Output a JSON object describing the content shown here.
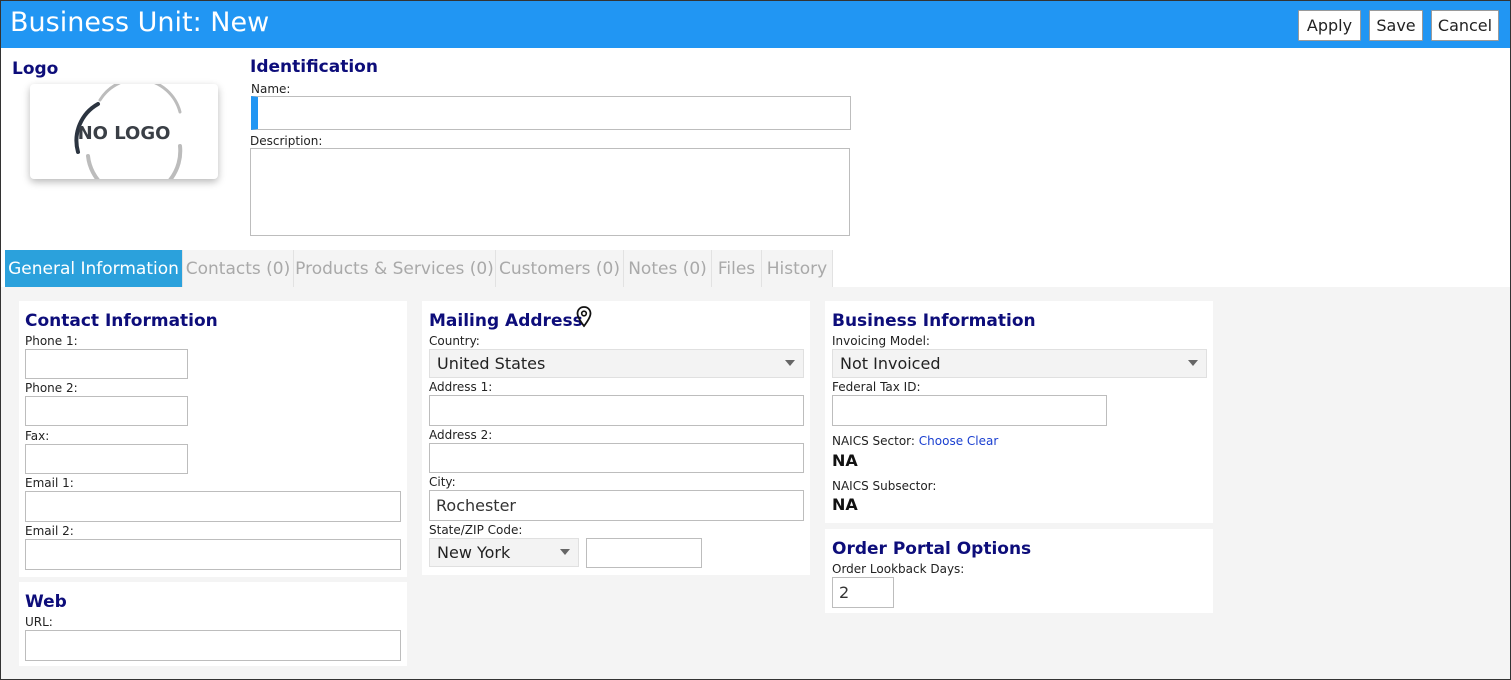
{
  "header": {
    "title": "Business Unit: New",
    "apply_label": "Apply",
    "save_label": "Save",
    "cancel_label": "Cancel"
  },
  "logo": {
    "heading": "Logo",
    "placeholder_text": "NO LOGO"
  },
  "identification": {
    "heading": "Identification",
    "name_label": "Name:",
    "name_value": "",
    "description_label": "Description:",
    "description_value": ""
  },
  "tabs": [
    {
      "label": "General Information",
      "active": true
    },
    {
      "label": "Contacts (0)",
      "active": false
    },
    {
      "label": "Products & Services (0)",
      "active": false
    },
    {
      "label": "Customers (0)",
      "active": false
    },
    {
      "label": "Notes (0)",
      "active": false
    },
    {
      "label": "Files",
      "active": false
    },
    {
      "label": "History",
      "active": false
    }
  ],
  "contact_info": {
    "heading": "Contact Information",
    "phone1_label": "Phone 1:",
    "phone2_label": "Phone 2:",
    "fax_label": "Fax:",
    "email1_label": "Email 1:",
    "email2_label": "Email 2:"
  },
  "web": {
    "heading": "Web",
    "url_label": "URL:"
  },
  "mailing_address": {
    "heading": "Mailing Address",
    "country_label": "Country:",
    "country_value": "United States",
    "address1_label": "Address 1:",
    "address2_label": "Address 2:",
    "city_label": "City:",
    "city_value": "Rochester",
    "state_zip_label": "State/ZIP Code:",
    "state_value": "New York",
    "zip_value": ""
  },
  "business_info": {
    "heading": "Business Information",
    "invoicing_label": "Invoicing Model:",
    "invoicing_value": "Not Invoiced",
    "tax_id_label": "Federal Tax ID:",
    "naics_sector_label": "NAICS Sector:",
    "choose_link": "Choose",
    "clear_link": "Clear",
    "naics_sector_value": "NA",
    "naics_subsector_label": "NAICS Subsector:",
    "naics_subsector_value": "NA"
  },
  "order_portal": {
    "heading": "Order Portal Options",
    "lookback_label": "Order Lookback Days:",
    "lookback_value": "2"
  },
  "colors": {
    "header_bg": "#2196f3",
    "active_tab_bg": "#2ba1dc",
    "heading_color": "#0d0d7a",
    "link_color": "#1a3fd0"
  }
}
